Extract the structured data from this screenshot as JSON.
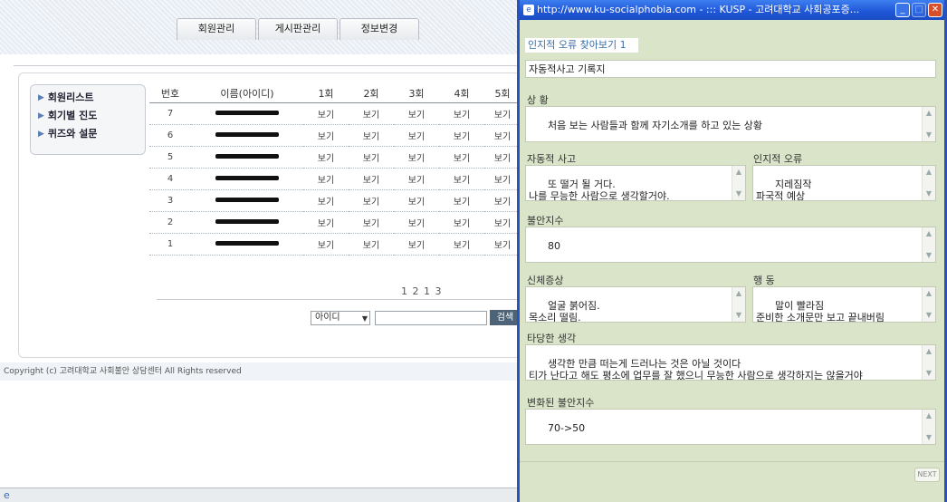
{
  "background": {
    "tabs": [
      "회원관리",
      "게시판관리",
      "정보변경"
    ],
    "menu": [
      "회원리스트",
      "회기별 진도",
      "퀴즈와 설문"
    ],
    "table": {
      "headers": [
        "번호",
        "이름(아이디)",
        "1회",
        "2회",
        "3회",
        "4회",
        "5회"
      ],
      "rows": [
        {
          "no": "7",
          "cells": [
            "보기",
            "보기",
            "보기",
            "보기",
            "보기"
          ]
        },
        {
          "no": "6",
          "cells": [
            "보기",
            "보기",
            "보기",
            "보기",
            "보기"
          ]
        },
        {
          "no": "5",
          "cells": [
            "보기",
            "보기",
            "보기",
            "보기",
            "보기"
          ]
        },
        {
          "no": "4",
          "cells": [
            "보기",
            "보기",
            "보기",
            "보기",
            "보기"
          ]
        },
        {
          "no": "3",
          "cells": [
            "보기",
            "보기",
            "보기",
            "보기",
            "보기"
          ]
        },
        {
          "no": "2",
          "cells": [
            "보기",
            "보기",
            "보기",
            "보기",
            "보기"
          ]
        },
        {
          "no": "1",
          "cells": [
            "보기",
            "보기",
            "보기",
            "보기",
            "보기"
          ]
        }
      ]
    },
    "pager": "1 2 1 3",
    "search": {
      "select": "아이디",
      "button": "검색"
    },
    "copyright": "Copyright (c) 고려대학교 사회불안 상담센터 All Rights reserved"
  },
  "popup": {
    "title": "http://www.ku-socialphobia.com - ::: KUSP - 고려대학교 사회공포증...",
    "header": "인지적 오류 찾아보기 1",
    "section_title": "자동적사고 기록지",
    "situation_label": "상 황",
    "situation_text": "처음 보는 사람들과 함께 자기소개를 하고 있는 상황",
    "auto_thought_label": "자동적 사고",
    "auto_thought_text": "또 떨거 될 거다.\n나를 무능한 사람으로 생각할거야.",
    "cognitive_error_label": "인지적 오류",
    "cognitive_error_text": "지레짐작\n파국적 예상",
    "anxiety_label": "불안지수",
    "anxiety_value": "80",
    "physical_label": "신체증상",
    "physical_text": "얼굴 붉어짐.\n목소리 떨림.",
    "behavior_label": "행 동",
    "behavior_text": "말이 빨라짐\n준비한 소개문만 보고 끝내버림",
    "rational_label": "타당한 생각",
    "rational_text": "생각한 만큼 떠는게 드러나는 것은 아닐 것이다\n티가 난다고 해도 평소에 업무를 잘 했으니 무능한 사람으로 생각하지는 않을거야",
    "changed_label": "변화된 불안지수",
    "changed_value": "70->50",
    "next_label": "NEXT"
  }
}
